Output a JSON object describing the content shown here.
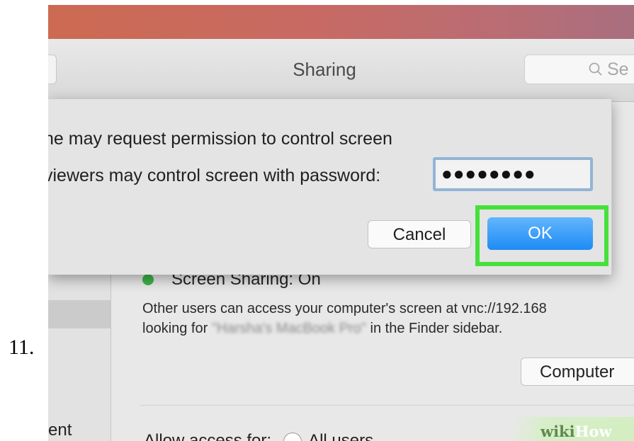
{
  "step_number": "11.",
  "window": {
    "title": "Sharing",
    "search_placeholder": "Se"
  },
  "dialog": {
    "line1": "ne may request permission to control screen",
    "line2": "viewers may control screen with password:",
    "password_value": "●●●●●●●●",
    "cancel_label": "Cancel",
    "ok_label": "OK",
    "highlight_color": "#46e03b"
  },
  "status": {
    "label": "Screen Sharing: On",
    "color": "#3bb44a"
  },
  "description": {
    "line1": "Other users can access your computer's screen at vnc://192.168",
    "line2_prefix": "looking for",
    "line2_blurred": "\"Harsha's MacBook Pro\"",
    "line2_suffix": "in the Finder sidebar."
  },
  "computer_button": "Computer",
  "sidebar": {
    "bottom_label": "ent"
  },
  "access": {
    "label": "Allow access for:",
    "option_all": "All users"
  },
  "watermark": {
    "wiki": "wiki",
    "how": "How"
  },
  "colors": {
    "ok_blue": "#1d8bf5",
    "desktop_red": "#cc6a52"
  }
}
